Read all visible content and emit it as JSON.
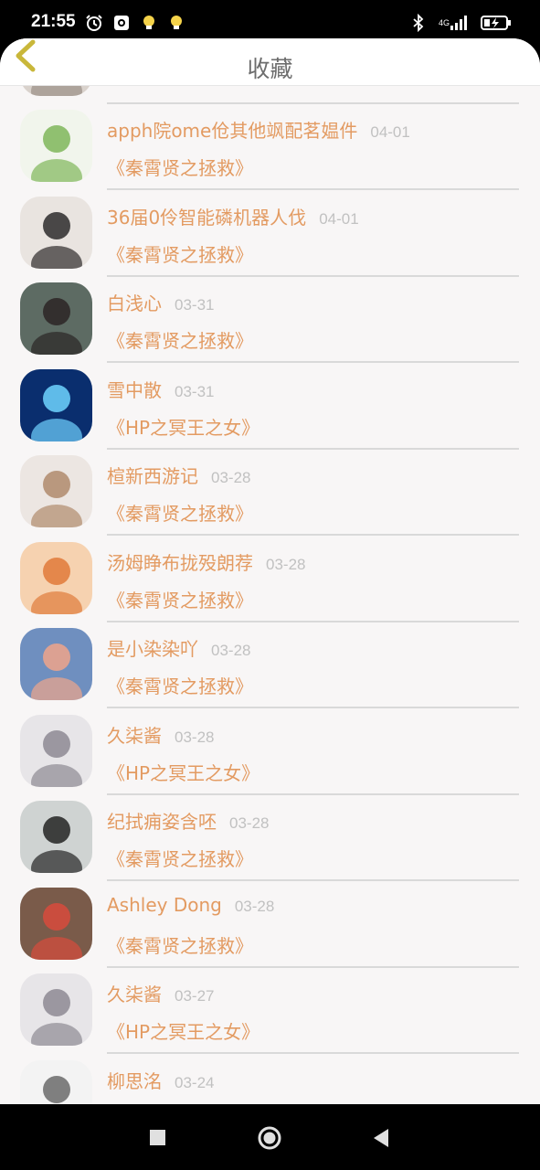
{
  "status_bar": {
    "time": "21:55",
    "left_icons": [
      "alarm-clock-icon",
      "camera-app-icon",
      "bulb-notification-icon",
      "bulb-notification-icon"
    ],
    "network_label": "4G",
    "right_icons": [
      "bluetooth-icon",
      "signal-4g-icon",
      "battery-charging-icon"
    ]
  },
  "header": {
    "title": "收藏",
    "back_icon": "chevron-left-icon"
  },
  "rows": [
    {
      "name": "",
      "date": "",
      "book": ""
    },
    {
      "name": "apph院ome伧其他飒配茗媪件",
      "date": "04-01",
      "book": "《秦霄贤之拯救》"
    },
    {
      "name": "36届0伶智能磷机器人伐",
      "date": "04-01",
      "book": "《秦霄贤之拯救》"
    },
    {
      "name": "白浅心",
      "date": "03-31",
      "book": "《秦霄贤之拯救》"
    },
    {
      "name": "雪中散",
      "date": "03-31",
      "book": "《HP之冥王之女》"
    },
    {
      "name": "楦新西游记",
      "date": "03-28",
      "book": "《秦霄贤之拯救》"
    },
    {
      "name": "汤姆睁布拢殁朗荐",
      "date": "03-28",
      "book": "《秦霄贤之拯救》"
    },
    {
      "name": "是小染染吖",
      "date": "03-28",
      "book": "《秦霄贤之拯救》"
    },
    {
      "name": "久柒酱",
      "date": "03-28",
      "book": "《HP之冥王之女》"
    },
    {
      "name": "纪拭痈姿含呸",
      "date": "03-28",
      "book": "《秦霄贤之拯救》"
    },
    {
      "name": "Ashley Dong",
      "date": "03-28",
      "book": "《秦霄贤之拯救》"
    },
    {
      "name": "久柒酱",
      "date": "03-27",
      "book": "《HP之冥王之女》"
    },
    {
      "name": "柳思洺",
      "date": "03-24",
      "book": ""
    }
  ],
  "avatar_themes": [
    {
      "bg": "#d9d2cc",
      "fg": "#9a8f86"
    },
    {
      "bg": "#f1f5ec",
      "fg": "#7fb65a"
    },
    {
      "bg": "#e9e4e0",
      "fg": "#2d2b2b"
    },
    {
      "bg": "#5d6b63",
      "fg": "#2b2525"
    },
    {
      "bg": "#0a2e6e",
      "fg": "#6fd3ff"
    },
    {
      "bg": "#ece6e2",
      "fg": "#b08a6c"
    },
    {
      "bg": "#f6d2b0",
      "fg": "#e07a3a"
    },
    {
      "bg": "#6f8fbf",
      "fg": "#f0a58a"
    },
    {
      "bg": "#e7e5e8",
      "fg": "#8d8a93"
    },
    {
      "bg": "#cfd3d2",
      "fg": "#232323"
    },
    {
      "bg": "#7a5b4a",
      "fg": "#d84b3c"
    },
    {
      "bg": "#e7e5e8",
      "fg": "#8d8a93"
    },
    {
      "bg": "#f3f3f3",
      "fg": "#6a6a6a"
    }
  ],
  "nav_bar": {
    "icons": [
      "recents-square-icon",
      "home-circle-icon",
      "back-triangle-icon"
    ]
  },
  "colors": {
    "accent": "#e39b62",
    "date": "#c1c1c1",
    "title": "#6d6d6d",
    "background": "#f8f6f6"
  }
}
